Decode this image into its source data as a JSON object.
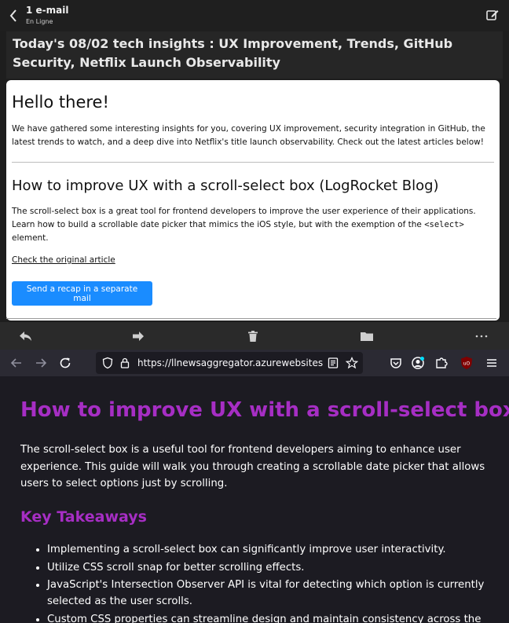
{
  "mail": {
    "header": {
      "count": "1 e-mail",
      "status": "En Ligne"
    },
    "subject": "Today's 08/02 tech insights : UX Improvement, Trends, GitHub Security, Netflix Launch Observability",
    "body": {
      "greeting": "Hello there!",
      "intro": "We have gathered some interesting insights for you, covering UX improvement, security integration in GitHub, the latest trends to watch, and a deep dive into Netflix's title launch observability. Check out the latest articles below!",
      "article_title": "How to improve UX with a scroll-select box (LogRocket Blog)",
      "article_desc_before": "The scroll-select box is a great tool for frontend developers to improve the user experience of their applications. Learn how to build a scrollable date picker that mimics the iOS style, but with the exemption of the ",
      "article_desc_code": "<select>",
      "article_desc_after": " element.",
      "original_link": "Check the original article",
      "recap_button": "Send a recap in a separate mail"
    },
    "toolbar_icons": [
      "reply-icon",
      "forward-icon",
      "trash-icon",
      "folder-icon",
      "more-icon"
    ]
  },
  "browser": {
    "url": "https://llnewsaggregator.azurewebsites.net",
    "toolbar_icons": [
      "back-arrow-icon",
      "forward-arrow-icon",
      "reload-icon",
      "shield-icon",
      "lock-icon",
      "reader-view-icon",
      "bookmark-star-icon",
      "pocket-icon",
      "account-icon",
      "extensions-icon",
      "ublock-icon",
      "menu-icon"
    ],
    "ublock_badge": "uO",
    "page": {
      "title": "How to improve UX with a scroll-select box",
      "intro": "The scroll-select box is a useful tool for frontend developers aiming to enhance user experience. This guide will walk you through creating a scrollable date picker that allows users to select options just by scrolling.",
      "takeaways_heading": "Key Takeaways",
      "takeaways": [
        "Implementing a scroll-select box can significantly improve user interactivity.",
        "Utilize CSS scroll snap for better scrolling effects.",
        "JavaScript's Intersection Observer API is vital for detecting which option is currently selected as the user scrolls.",
        "Custom CSS properties can streamline design and maintain consistency across the"
      ]
    }
  },
  "colors": {
    "accent_purple": "#a62ec4",
    "button_blue": "#1a8cff",
    "dark_bg": "#1c1b22"
  }
}
